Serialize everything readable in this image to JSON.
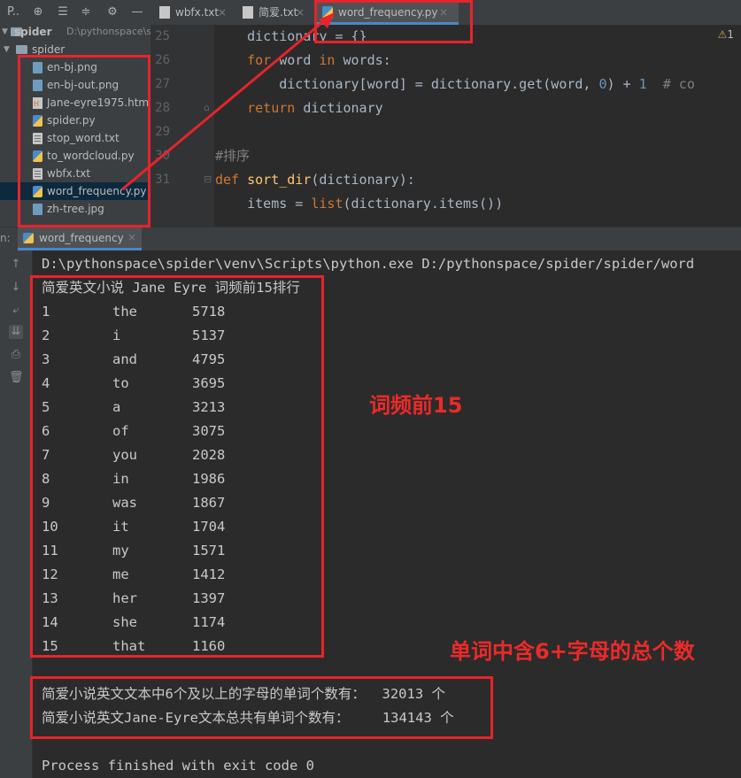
{
  "toolbar": {
    "project_label": "P..",
    "icons": [
      "target-icon",
      "collapse-icon",
      "expand-icon",
      "gear-icon",
      "minimize-icon"
    ]
  },
  "editor_tabs": [
    {
      "label": "wbfx.txt",
      "type": "text"
    },
    {
      "label": "简爱.txt",
      "type": "text"
    },
    {
      "label": "word_frequency.py",
      "type": "python",
      "active": true
    }
  ],
  "project": {
    "root_label": "spider",
    "root_path": "D:\\pythonspace\\sp",
    "folder_label": "spider",
    "files": [
      {
        "name": "en-bj.png",
        "type": "image"
      },
      {
        "name": "en-bj-out.png",
        "type": "image"
      },
      {
        "name": "Jane-eyre1975.html",
        "type": "html"
      },
      {
        "name": "spider.py",
        "type": "python"
      },
      {
        "name": "stop_word.txt",
        "type": "text"
      },
      {
        "name": "to_wordcloud.py",
        "type": "python"
      },
      {
        "name": "wbfx.txt",
        "type": "text"
      },
      {
        "name": "word_frequency.py",
        "type": "python",
        "selected": true
      },
      {
        "name": "zh-tree.jpg",
        "type": "image"
      }
    ]
  },
  "editor": {
    "warning_count": "1",
    "line_numbers": [
      "25",
      "26",
      "27",
      "28",
      "29",
      "30",
      "31"
    ]
  },
  "run": {
    "tab_label": "word_frequency",
    "command": "D:\\pythonspace\\spider\\venv\\Scripts\\python.exe D:/pythonspace/spider/spider/word",
    "header": "简爱英文小说 Jane Eyre 词频前15排行",
    "rows": [
      {
        "rank": "1",
        "word": "the",
        "count": "5718"
      },
      {
        "rank": "2",
        "word": "i",
        "count": "5137"
      },
      {
        "rank": "3",
        "word": "and",
        "count": "4795"
      },
      {
        "rank": "4",
        "word": "to",
        "count": "3695"
      },
      {
        "rank": "5",
        "word": "a",
        "count": "3213"
      },
      {
        "rank": "6",
        "word": "of",
        "count": "3075"
      },
      {
        "rank": "7",
        "word": "you",
        "count": "2028"
      },
      {
        "rank": "8",
        "word": "in",
        "count": "1986"
      },
      {
        "rank": "9",
        "word": "was",
        "count": "1867"
      },
      {
        "rank": "10",
        "word": "it",
        "count": "1704"
      },
      {
        "rank": "11",
        "word": "my",
        "count": "1571"
      },
      {
        "rank": "12",
        "word": "me",
        "count": "1412"
      },
      {
        "rank": "13",
        "word": "her",
        "count": "1397"
      },
      {
        "rank": "14",
        "word": "she",
        "count": "1174"
      },
      {
        "rank": "15",
        "word": "that",
        "count": "1160"
      }
    ],
    "summary_line1": "简爱小说英文文本中6个及以上的字母的单词个数有：  32013 个",
    "summary_line2": "简爱小说英文Jane-Eyre文本总共有单词个数有：    134143 个",
    "exit_line": "Process finished with exit code 0"
  },
  "annotations": {
    "top15_label": "词频前15",
    "six_plus_label": "单词中含6+字母的总个数",
    "color": "#e8232b"
  }
}
